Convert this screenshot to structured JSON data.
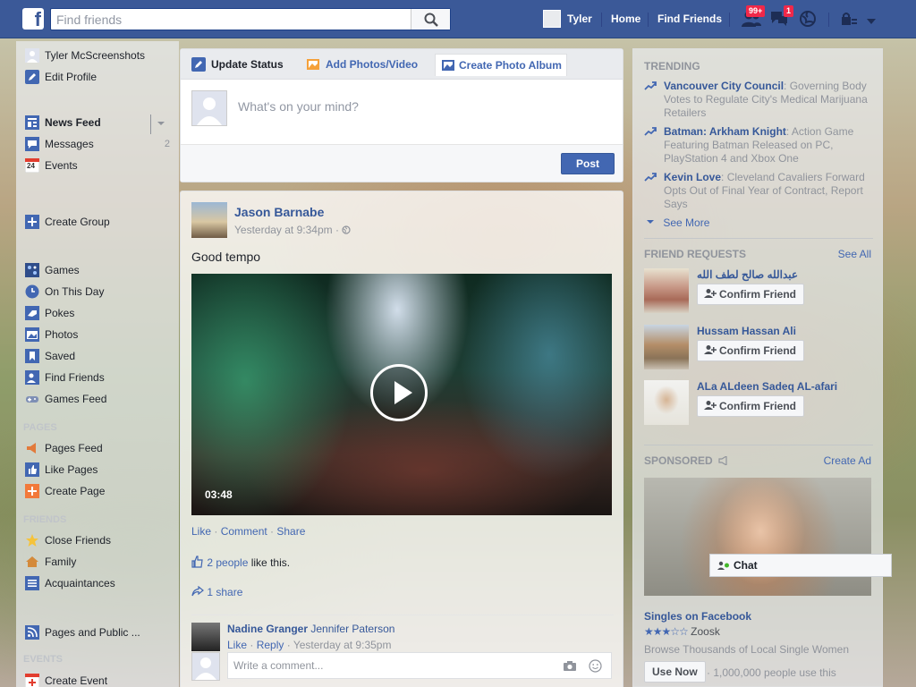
{
  "header": {
    "logo": "f",
    "search_placeholder": "Find friends",
    "user_name": "Tyler",
    "home": "Home",
    "find_friends": "Find Friends",
    "friend_requests_badge": "99+",
    "messages_badge": "1"
  },
  "sidebar": {
    "profile_name": "Tyler McScreenshots",
    "edit_profile": "Edit Profile",
    "favorites": [
      {
        "label": "News Feed",
        "count": ""
      },
      {
        "label": "Messages",
        "count": "2"
      },
      {
        "label": "Events",
        "count": ""
      }
    ],
    "events_icon_text": "24",
    "create_group": "Create Group",
    "apps": [
      "Games",
      "On This Day",
      "Pokes",
      "Photos",
      "Saved",
      "Find Friends",
      "Games Feed"
    ],
    "pages_header": "PAGES",
    "pages": [
      "Pages Feed",
      "Like Pages",
      "Create Page"
    ],
    "friends_header": "FRIENDS",
    "friends": [
      "Close Friends",
      "Family",
      "Acquaintances"
    ],
    "interests": [
      "Pages and Public ..."
    ],
    "events_header": "EVENTS",
    "events": [
      "Create Event"
    ]
  },
  "composer": {
    "tabs": [
      "Update Status",
      "Add Photos/Video",
      "Create Photo Album"
    ],
    "placeholder": "What's on your mind?",
    "post_button": "Post"
  },
  "story": {
    "author": "Jason Barnabe",
    "time": "Yesterday at 9:34pm ·",
    "text": "Good tempo",
    "video_duration": "03:48",
    "actions": [
      "Like",
      "Comment",
      "Share"
    ],
    "likes_count": "2 people",
    "likes_suffix": " like this.",
    "shares": "1 share",
    "comment": {
      "author": "Nadine Granger",
      "tagged": "Jennifer Paterson",
      "like": "Like",
      "reply": "Reply",
      "time": "Yesterday at 9:35pm"
    },
    "write_comment_placeholder": "Write a comment..."
  },
  "trending": {
    "header": "TRENDING",
    "items": [
      {
        "topic": "Vancouver City Council",
        "desc": ": Governing Body Votes to Regulate City's Medical Marijuana Retailers"
      },
      {
        "topic": "Batman: Arkham Knight",
        "desc": ": Action Game Featuring Batman Released on PC, PlayStation 4 and Xbox One"
      },
      {
        "topic": "Kevin Love",
        "desc": ": Cleveland Cavaliers Forward Opts Out of Final Year of Contract, Report Says"
      }
    ],
    "see_more": "See More"
  },
  "friend_requests": {
    "header": "FRIEND REQUESTS",
    "see_all": "See All",
    "confirm_label": "Confirm Friend",
    "items": [
      {
        "name": "عبدالله صالح لطف الله"
      },
      {
        "name": "Hussam Hassan Ali"
      },
      {
        "name": "ALa ALdeen Sadeq AL-afari"
      }
    ]
  },
  "sponsored": {
    "header": "SPONSORED",
    "create_ad": "Create Ad",
    "title": "Singles on Facebook",
    "rating": 2.5,
    "brand": "Zoosk",
    "desc": "Browse Thousands of Local Single Women",
    "cta": "Use Now",
    "social": "· 1,000,000 people use this"
  },
  "chat": {
    "label": "Chat"
  },
  "colors": {
    "brand": "#3b5998",
    "link": "#365899",
    "button": "#4267b2",
    "badge": "#f02849"
  }
}
